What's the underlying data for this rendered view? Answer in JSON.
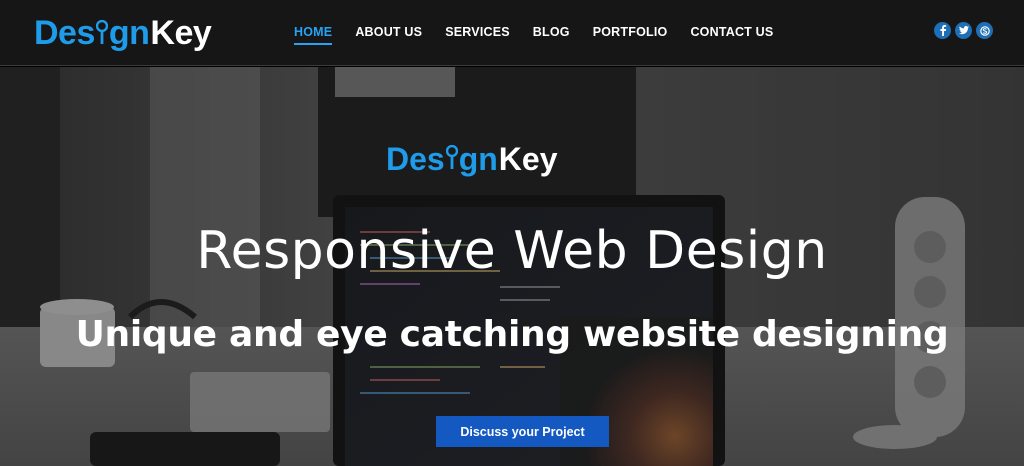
{
  "brand": {
    "name_part1": "Des",
    "name_part2": "gn",
    "name_part3": "Key",
    "colors": {
      "primary_blue": "#1e9be9",
      "white": "#ffffff",
      "button": "#1458c2",
      "nav_active": "#26a3f4"
    }
  },
  "nav": {
    "items": [
      {
        "label": "HOME",
        "active": true
      },
      {
        "label": "ABOUT US",
        "active": false
      },
      {
        "label": "SERVICES",
        "active": false
      },
      {
        "label": "BLOG",
        "active": false
      },
      {
        "label": "PORTFOLIO",
        "active": false
      },
      {
        "label": "CONTACT US",
        "active": false
      }
    ]
  },
  "social": {
    "icons": [
      {
        "name": "facebook-icon",
        "glyph": "f"
      },
      {
        "name": "twitter-icon",
        "glyph": "t"
      },
      {
        "name": "skype-icon",
        "glyph": "S"
      }
    ]
  },
  "hero": {
    "title": "Responsive Web Design",
    "subtitle": "Unique and eye catching website designing",
    "cta_label": "Discuss your Project"
  }
}
